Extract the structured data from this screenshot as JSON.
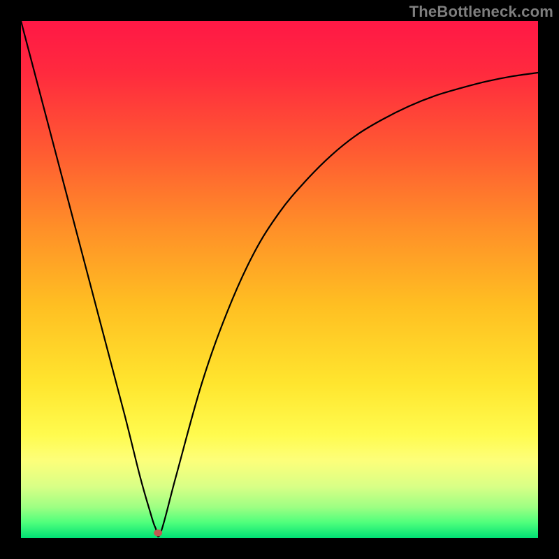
{
  "watermark": "TheBottleneck.com",
  "chart_data": {
    "type": "line",
    "title": "",
    "xlabel": "",
    "ylabel": "",
    "xlim": [
      0,
      100
    ],
    "ylim": [
      0,
      100
    ],
    "grid": false,
    "series": [
      {
        "name": "curve",
        "x": [
          0,
          5,
          10,
          15,
          20,
          23,
          25,
          26,
          27,
          30,
          35,
          40,
          45,
          50,
          55,
          60,
          65,
          70,
          75,
          80,
          85,
          90,
          95,
          100
        ],
        "y": [
          100,
          81,
          62,
          43,
          24,
          12,
          5,
          2,
          1,
          12,
          30,
          44,
          55,
          63,
          69,
          74,
          78,
          81,
          83.5,
          85.5,
          87,
          88.3,
          89.3,
          90
        ]
      }
    ],
    "marker": {
      "x": 26.5,
      "y": 1
    },
    "gradient_stops": [
      {
        "offset": 0.0,
        "color": "#ff1846"
      },
      {
        "offset": 0.1,
        "color": "#ff2a3e"
      },
      {
        "offset": 0.25,
        "color": "#ff5a32"
      },
      {
        "offset": 0.4,
        "color": "#ff8f28"
      },
      {
        "offset": 0.55,
        "color": "#ffbf22"
      },
      {
        "offset": 0.7,
        "color": "#ffe52e"
      },
      {
        "offset": 0.8,
        "color": "#fffb4e"
      },
      {
        "offset": 0.85,
        "color": "#fdff7a"
      },
      {
        "offset": 0.9,
        "color": "#d9ff86"
      },
      {
        "offset": 0.94,
        "color": "#9eff83"
      },
      {
        "offset": 0.97,
        "color": "#4fff7c"
      },
      {
        "offset": 1.0,
        "color": "#00e074"
      }
    ],
    "marker_color": "#c15a52",
    "curve_color": "#000000"
  }
}
